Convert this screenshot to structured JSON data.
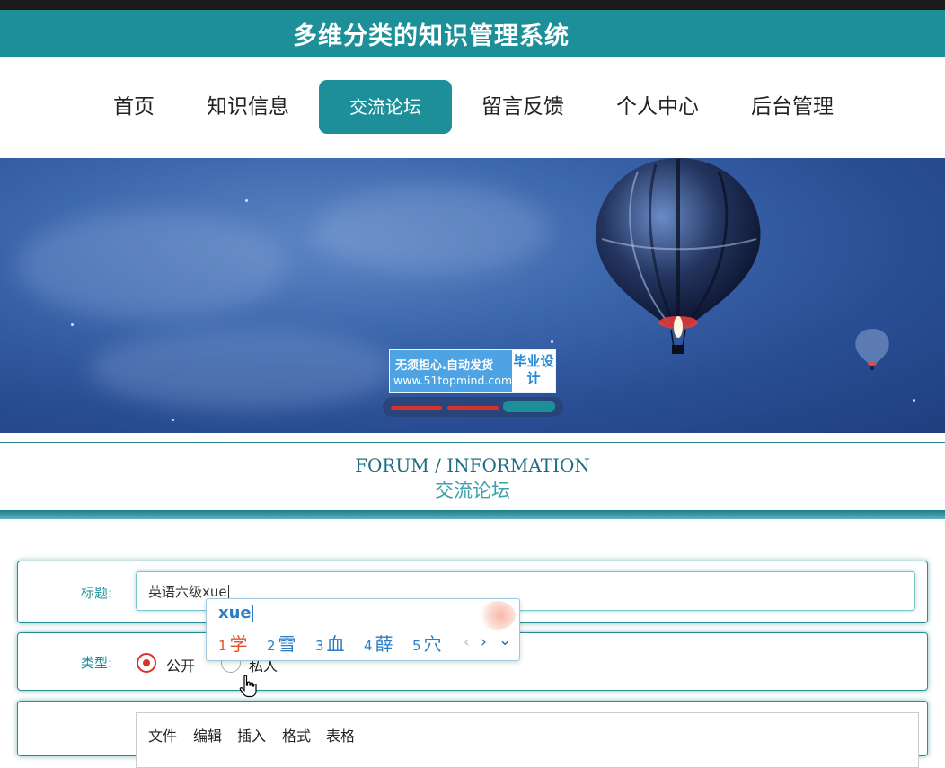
{
  "header": {
    "site_title": "多维分类的知识管理系统",
    "brand_color": "#1c8f99"
  },
  "nav": {
    "items": [
      {
        "label": "首页"
      },
      {
        "label": "知识信息"
      },
      {
        "label": "交流论坛",
        "active": true
      },
      {
        "label": "留言反馈"
      },
      {
        "label": "个人中心"
      },
      {
        "label": "后台管理"
      }
    ]
  },
  "banner": {
    "watermark_line1": "无须担心.自动发货",
    "watermark_line2": "www.51topmind.com",
    "watermark_badge": "毕业设计",
    "carousel_slides": 3,
    "active_slide": 3
  },
  "section": {
    "title_en": "FORUM / INFORMATION",
    "title_zh": "交流论坛"
  },
  "form": {
    "title_label": "标题:",
    "title_value": "英语六级xue",
    "type_label": "类型:",
    "type_options": [
      {
        "label": "公开",
        "selected": true
      },
      {
        "label": "私人",
        "selected": false
      }
    ],
    "editor_menu": [
      "文件",
      "编辑",
      "插入",
      "格式",
      "表格"
    ]
  },
  "ime": {
    "composition": "xue",
    "candidates": [
      {
        "n": "1",
        "text": "学"
      },
      {
        "n": "2",
        "text": "雪"
      },
      {
        "n": "3",
        "text": "血"
      },
      {
        "n": "4",
        "text": "薛"
      },
      {
        "n": "5",
        "text": "穴"
      }
    ],
    "prev_icon": "‹",
    "next_icon": "›",
    "expand_icon": "⌄"
  }
}
